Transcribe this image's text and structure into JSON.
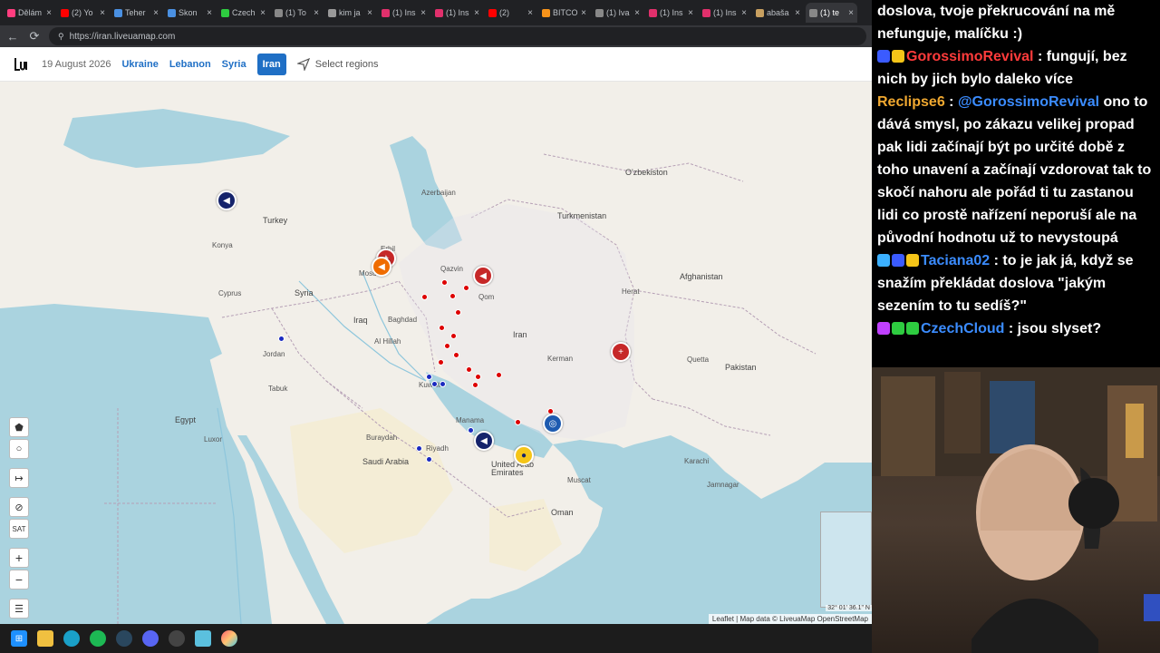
{
  "browser": {
    "tabs": [
      {
        "title": "Dělám",
        "color": "#ff3d7f",
        "active": false
      },
      {
        "title": "(2) Yo",
        "color": "#ff0000",
        "active": false
      },
      {
        "title": "Teher",
        "color": "#4a90e2",
        "active": false
      },
      {
        "title": "Skon",
        "color": "#4a90e2",
        "active": false
      },
      {
        "title": "Czech",
        "color": "#2ecc40",
        "active": false
      },
      {
        "title": "(1) To",
        "color": "#888888",
        "active": false
      },
      {
        "title": "kim ja",
        "color": "#999999",
        "active": false
      },
      {
        "title": "(1) Ins",
        "color": "#e1306c",
        "active": false
      },
      {
        "title": "(1) Ins",
        "color": "#e1306c",
        "active": false
      },
      {
        "title": "(2)",
        "color": "#ff0000",
        "active": false
      },
      {
        "title": "BITCO",
        "color": "#f7931a",
        "active": false
      },
      {
        "title": "(1) Iva",
        "color": "#888888",
        "active": false
      },
      {
        "title": "(1) Ins",
        "color": "#e1306c",
        "active": false
      },
      {
        "title": "(1) Ins",
        "color": "#e1306c",
        "active": false
      },
      {
        "title": "abaša",
        "color": "#c8a060",
        "active": false
      },
      {
        "title": "(1) te",
        "color": "#888888",
        "active": true
      }
    ],
    "url": "https://iran.liveuamap.com"
  },
  "header": {
    "date": "19 August 2026",
    "regions": [
      "Ukraine",
      "Lebanon",
      "Syria",
      "Iran"
    ],
    "active_region": "Iran",
    "select_regions": "Select regions"
  },
  "map": {
    "labels": {
      "turkey": "Turkey",
      "syria": "Syria",
      "iraq": "Iraq",
      "iran": "Iran",
      "saudi": "Saudi Arabia",
      "egypt": "Egypt",
      "oman": "Oman",
      "uae": "United Arab Emirates",
      "pakistan": "Pakistan",
      "afghanistan": "Afghanistan",
      "turkmenistan": "Turkmenistan",
      "uzbekistan": "O'zbekiston",
      "jordan": "Jordan",
      "cyprus": "Cyprus",
      "kuwait": "Kuwait",
      "azerbaijan": "Azerbaijan",
      "baghdad": "Baghdad",
      "qom": "Qom",
      "muscat": "Muscat",
      "kerman": "Kerman",
      "herat": "Herat",
      "quetta": "Quetta",
      "karachi": "Karachi",
      "riyadh": "Riyadh",
      "mosul": "Mosul",
      "konya": "Konya",
      "luxor": "Luxor",
      "manama": "Manama",
      "buraydah": "Buraydah",
      "jamnagar": "Jamnagar",
      "tabuk": "Tabuk",
      "al_hillah": "Al Hillah",
      "erbil": "Erbil",
      "qazvin": "Qazvin"
    },
    "attribution": "Leaflet | Map data © LiveuaMap OpenStreetMap",
    "coords": "32° 01' 36.1\" N",
    "controls": {
      "sat": "SAT",
      "zoom_in": "+",
      "zoom_out": "−"
    }
  },
  "chat": {
    "messages": [
      {
        "user": "",
        "user_color": "#ffffff",
        "text": "doslova, tvoje překrucování na mě nefunguje, malíčku :)"
      },
      {
        "user": "GorossimoRevival",
        "user_color": "#ff3b3b",
        "text": " : fungují, bez nich by jich bylo daleko více"
      },
      {
        "user": "Reclipse6",
        "user_color": "#f0a830",
        "text": " : @GorossimoRevival ono to dává smysl, po zákazu velikej propad pak lidi začínají být po určité době z toho unavení a začínají vzdorovat tak to skočí nahoru ale pořád ti tu zastanou lidi co prostě nařízení neporuší ale na původní hodnotu už to nevystoupá"
      },
      {
        "user": "Taciana02",
        "user_color": "#3b8cff",
        "text": " : to je jak já, když se snažím překládat doslova \"jakým sezením to tu sedíš?\""
      },
      {
        "user": "CzechCloud",
        "user_color": "#3b8cff",
        "text": " : jsou slyset?"
      }
    ],
    "mention": "@GorossimoRevival"
  }
}
